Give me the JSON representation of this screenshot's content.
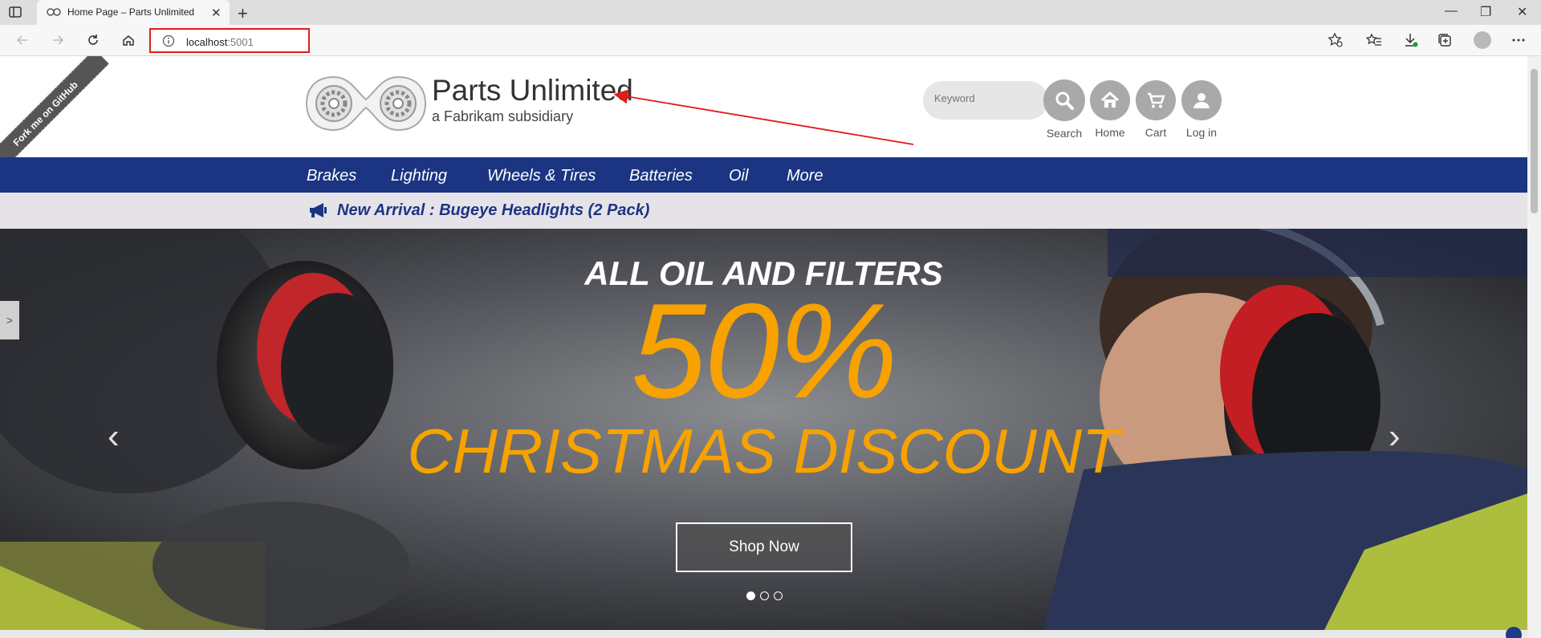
{
  "browser": {
    "tab_title": "Home Page – Parts Unlimited",
    "tab_close": "✕",
    "new_tab": "+",
    "url_host": "localhost",
    "url_port": ":5001",
    "window_controls": [
      "—",
      "❐",
      "✕"
    ]
  },
  "site": {
    "fork_ribbon": "Fork me on GitHub",
    "brand_name": "Parts Unlimited",
    "brand_sub": "a Fabrikam subsidiary",
    "search_placeholder": "Keyword",
    "search_label": "Search",
    "home_label": "Home",
    "cart_label": "Cart",
    "login_label": "Log in"
  },
  "nav": {
    "items": [
      "Brakes",
      "Lighting",
      "Wheels & Tires",
      "Batteries",
      "Oil",
      "More"
    ]
  },
  "announcement": "New Arrival : Bugeye Headlights (2 Pack)",
  "hero": {
    "line1": "ALL OIL AND FILTERS",
    "line2": "50%",
    "line3": "CHRISTMAS DISCOUNT",
    "button": "Shop Now",
    "prev": "‹",
    "next": "›",
    "side_toggle": ">",
    "slide_count": 3,
    "active_slide": 1
  },
  "colors": {
    "nav_blue": "#1b3583",
    "hero_orange": "#f7a200",
    "annotation_red": "#e01b1b"
  }
}
